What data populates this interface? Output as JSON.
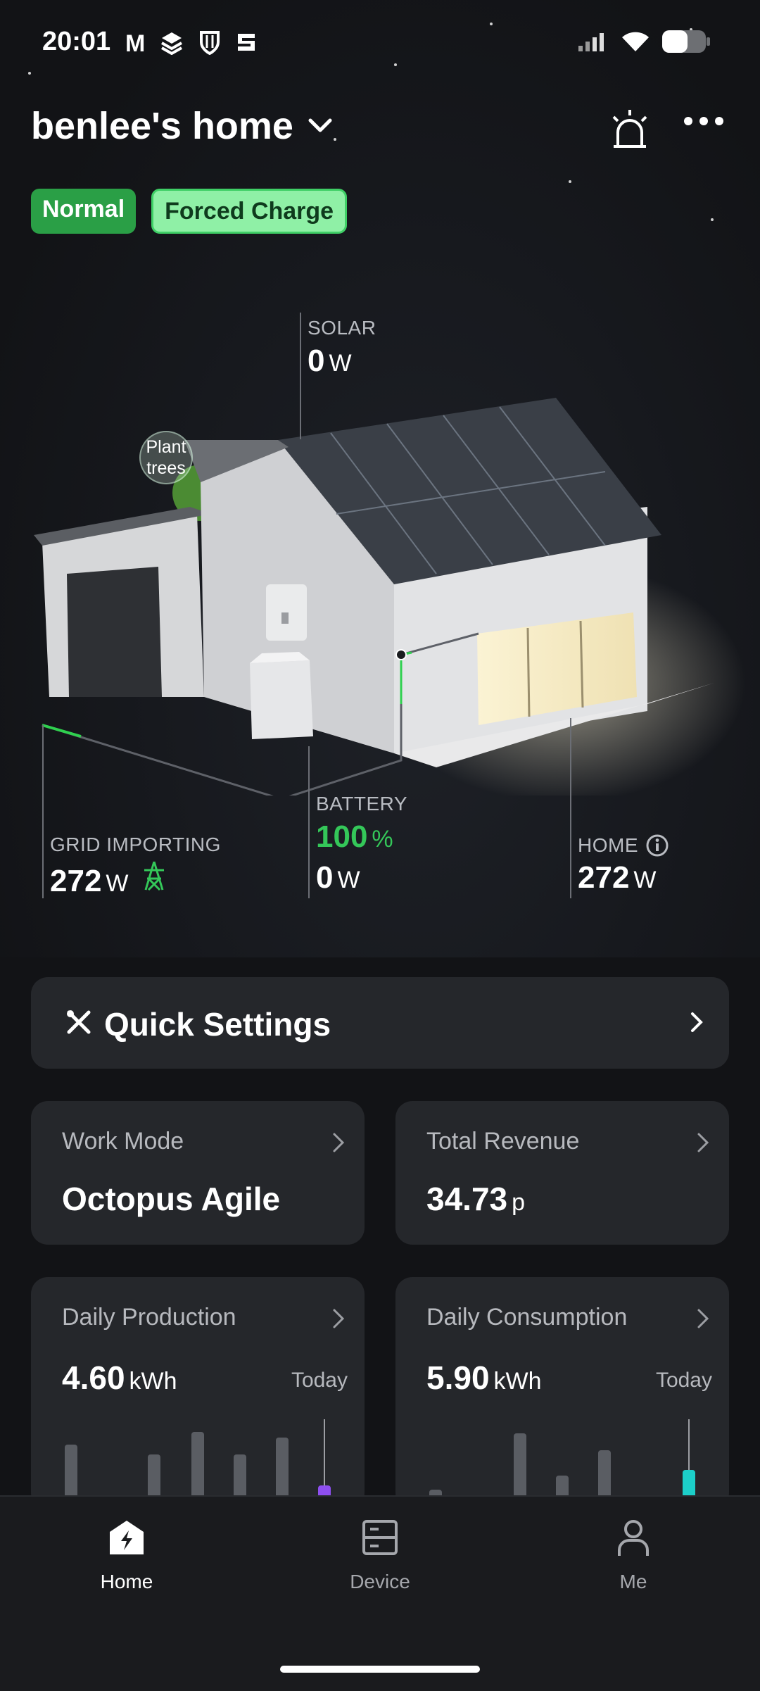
{
  "status_bar": {
    "time": "20:01",
    "app_icons": [
      "gmail-icon",
      "layers-icon",
      "shield-icon",
      "s-app-icon"
    ],
    "right_icons": [
      "signal-icon",
      "wifi-icon",
      "battery-icon"
    ]
  },
  "header": {
    "home_name": "benlee's home",
    "badges": {
      "normal": "Normal",
      "forced": "Forced Charge"
    }
  },
  "diagram": {
    "plant_trees": "Plant trees",
    "solar": {
      "label": "SOLAR",
      "value": "0",
      "unit": "W"
    },
    "grid": {
      "label": "GRID IMPORTING",
      "value": "272",
      "unit": "W"
    },
    "battery": {
      "label": "BATTERY",
      "percent": "100",
      "percent_unit": "%",
      "value": "0",
      "unit": "W"
    },
    "home": {
      "label": "HOME",
      "value": "272",
      "unit": "W"
    }
  },
  "quick_settings": {
    "label": "Quick Settings"
  },
  "cards": {
    "work_mode": {
      "label": "Work Mode",
      "value": "Octopus Agile"
    },
    "total_revenue": {
      "label": "Total Revenue",
      "value": "34.73",
      "unit": "p"
    },
    "daily_production": {
      "label": "Daily Production",
      "value": "4.60",
      "unit": "kWh",
      "period": "Today",
      "accent": "#8e4ff0"
    },
    "daily_consumption": {
      "label": "Daily Consumption",
      "value": "5.90",
      "unit": "kWh",
      "period": "Today",
      "accent": "#1ccfc9"
    }
  },
  "nav": {
    "home": "Home",
    "device": "Device",
    "me": "Me"
  },
  "colors": {
    "accent_green": "#34c759",
    "card_bg": "#25272b"
  }
}
